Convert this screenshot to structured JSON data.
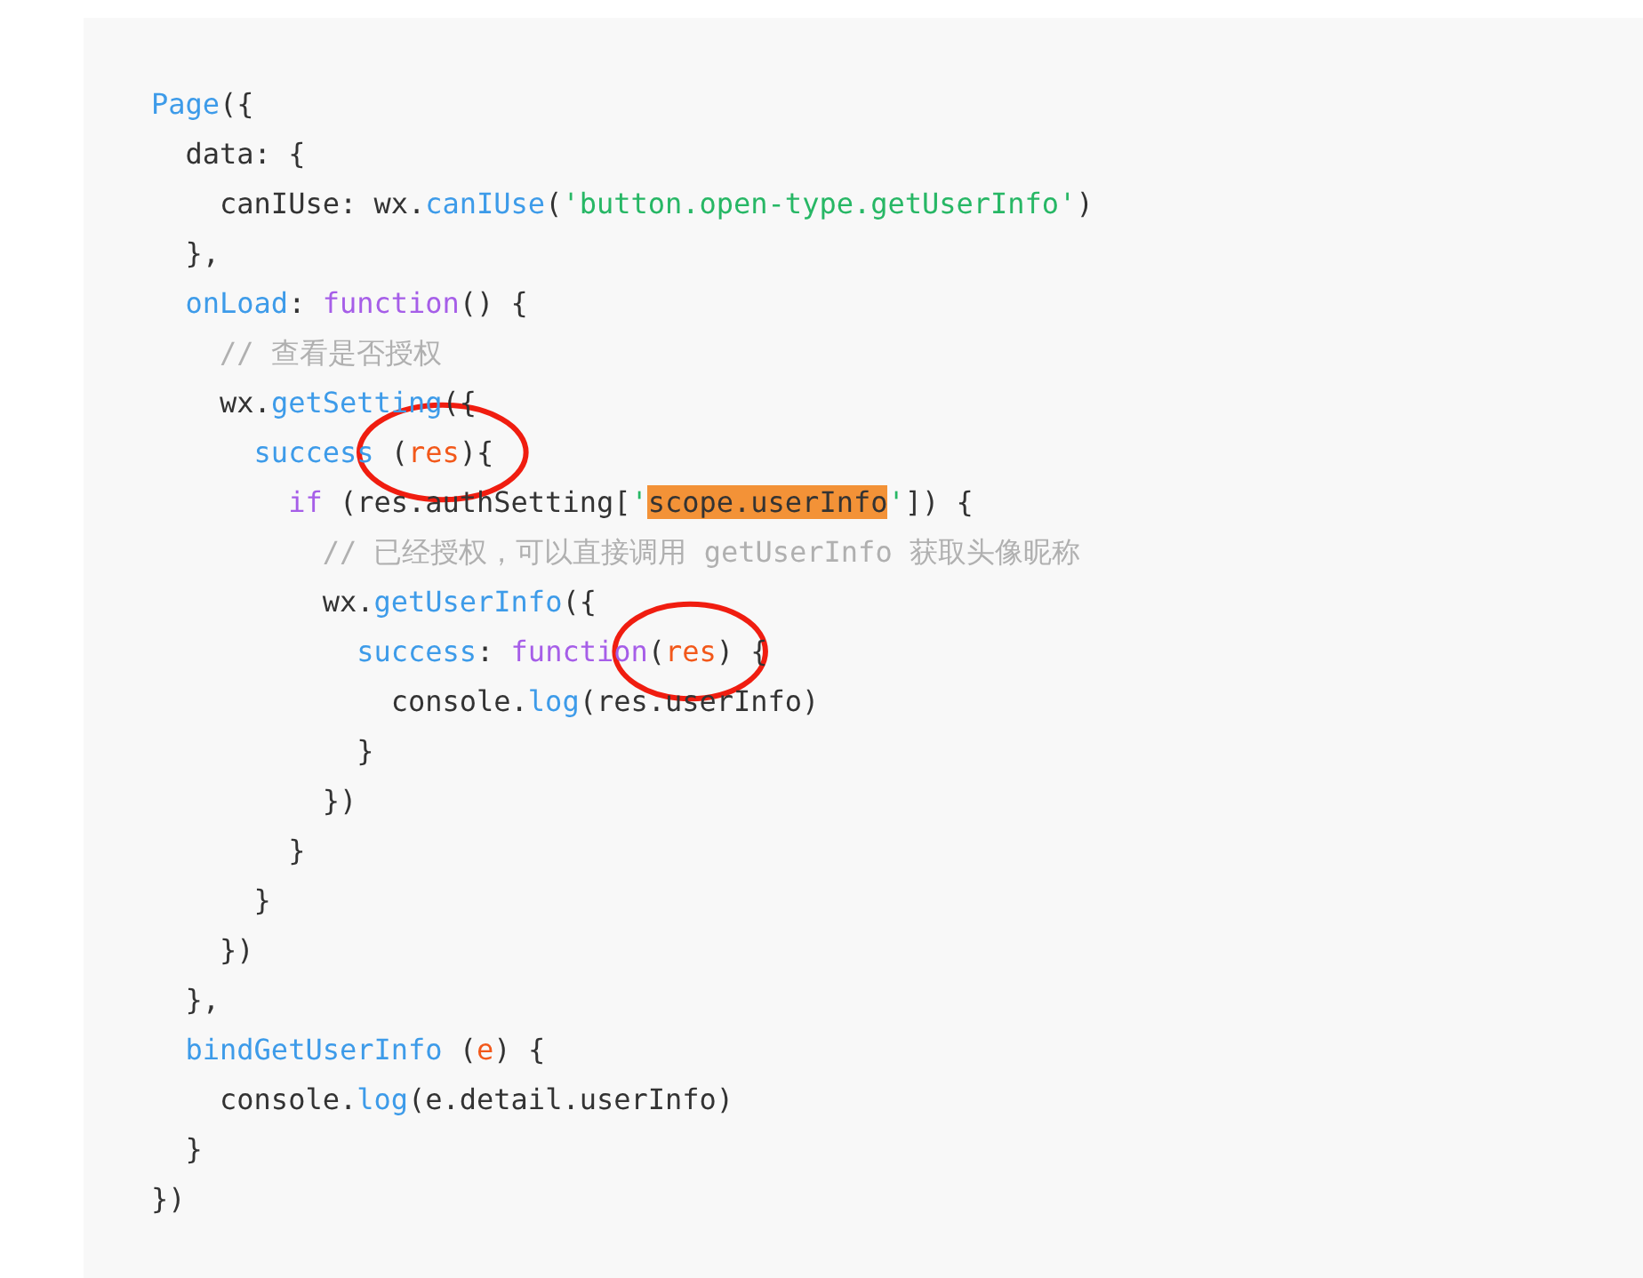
{
  "code_block": {
    "lines": [
      {
        "tokens": [
          {
            "kind": "func",
            "text": "Page"
          },
          {
            "kind": "plain",
            "text": "({"
          }
        ]
      },
      {
        "tokens": [
          {
            "kind": "plain",
            "text": "  data: {"
          }
        ]
      },
      {
        "tokens": [
          {
            "kind": "plain",
            "text": "    canIUse: wx."
          },
          {
            "kind": "func",
            "text": "canIUse"
          },
          {
            "kind": "plain",
            "text": "("
          },
          {
            "kind": "string",
            "text": "'button.open-type.getUserInfo'"
          },
          {
            "kind": "plain",
            "text": ")"
          }
        ]
      },
      {
        "tokens": [
          {
            "kind": "plain",
            "text": "  },"
          }
        ]
      },
      {
        "tokens": [
          {
            "kind": "func",
            "text": "  onLoad"
          },
          {
            "kind": "plain",
            "text": ": "
          },
          {
            "kind": "keyword",
            "text": "function"
          },
          {
            "kind": "plain",
            "text": "() {"
          }
        ]
      },
      {
        "tokens": [
          {
            "kind": "comment",
            "text": "    // 查看是否授权"
          }
        ]
      },
      {
        "tokens": [
          {
            "kind": "plain",
            "text": "    wx."
          },
          {
            "kind": "func",
            "text": "getSetting"
          },
          {
            "kind": "plain",
            "text": "({"
          }
        ]
      },
      {
        "tokens": [
          {
            "kind": "func",
            "text": "      success "
          },
          {
            "kind": "circled",
            "tokens": [
              {
                "kind": "plain",
                "text": "("
              },
              {
                "kind": "param",
                "text": "res"
              },
              {
                "kind": "plain",
                "text": "){"
              }
            ]
          }
        ]
      },
      {
        "tokens": [
          {
            "kind": "keyword",
            "text": "        if"
          },
          {
            "kind": "plain",
            "text": " (res.authSetting["
          },
          {
            "kind": "string",
            "text": "'"
          },
          {
            "kind": "highlight",
            "text": "scope.userInfo"
          },
          {
            "kind": "string",
            "text": "'"
          },
          {
            "kind": "plain",
            "text": "]) {"
          }
        ]
      },
      {
        "tokens": [
          {
            "kind": "comment",
            "text": "          // 已经授权，可以直接调用 getUserInfo 获取头像昵称"
          }
        ]
      },
      {
        "tokens": [
          {
            "kind": "plain",
            "text": "          wx."
          },
          {
            "kind": "func",
            "text": "getUserInfo"
          },
          {
            "kind": "plain",
            "text": "({"
          }
        ]
      },
      {
        "tokens": [
          {
            "kind": "func",
            "text": "            success"
          },
          {
            "kind": "plain",
            "text": ": "
          },
          {
            "kind": "keyword",
            "text": "function"
          },
          {
            "kind": "circled",
            "tokens": [
              {
                "kind": "plain",
                "text": "("
              },
              {
                "kind": "param",
                "text": "res"
              },
              {
                "kind": "plain",
                "text": ")"
              }
            ]
          },
          {
            "kind": "plain",
            "text": " {"
          }
        ]
      },
      {
        "tokens": [
          {
            "kind": "plain",
            "text": "              console."
          },
          {
            "kind": "func",
            "text": "log"
          },
          {
            "kind": "plain",
            "text": "(res.userInfo)"
          }
        ]
      },
      {
        "tokens": [
          {
            "kind": "plain",
            "text": "            }"
          }
        ]
      },
      {
        "tokens": [
          {
            "kind": "plain",
            "text": "          })"
          }
        ]
      },
      {
        "tokens": [
          {
            "kind": "plain",
            "text": "        }"
          }
        ]
      },
      {
        "tokens": [
          {
            "kind": "plain",
            "text": "      }"
          }
        ]
      },
      {
        "tokens": [
          {
            "kind": "plain",
            "text": "    })"
          }
        ]
      },
      {
        "tokens": [
          {
            "kind": "plain",
            "text": "  },"
          }
        ]
      },
      {
        "tokens": [
          {
            "kind": "func",
            "text": "  bindGetUserInfo"
          },
          {
            "kind": "plain",
            "text": " ("
          },
          {
            "kind": "param",
            "text": "e"
          },
          {
            "kind": "plain",
            "text": ") {"
          }
        ]
      },
      {
        "tokens": [
          {
            "kind": "plain",
            "text": "    console."
          },
          {
            "kind": "func",
            "text": "log"
          },
          {
            "kind": "plain",
            "text": "(e.detail.userInfo)"
          }
        ]
      },
      {
        "tokens": [
          {
            "kind": "plain",
            "text": "  }"
          }
        ]
      },
      {
        "tokens": [
          {
            "kind": "plain",
            "text": "})"
          }
        ]
      }
    ]
  }
}
